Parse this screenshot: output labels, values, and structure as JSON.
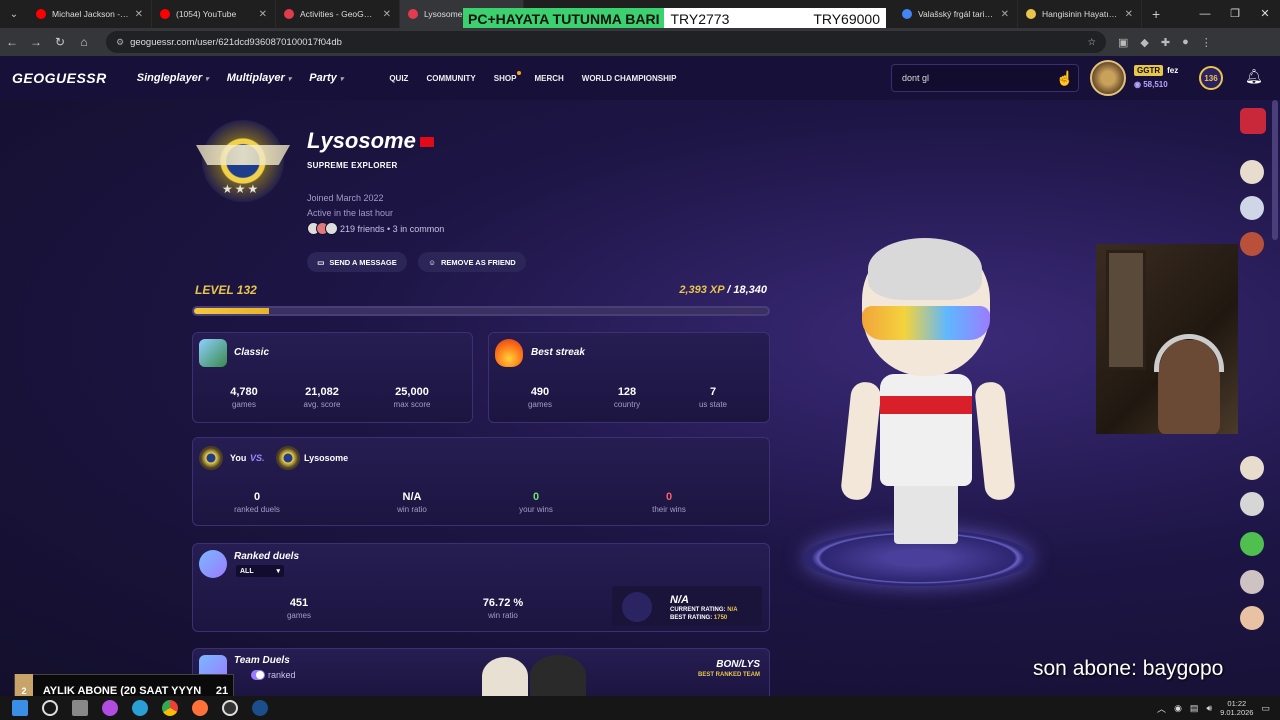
{
  "browser": {
    "tabs": [
      {
        "title": "Michael Jackson - Th",
        "favicon_color": "#ff0000"
      },
      {
        "title": "(1054) YouTube",
        "favicon_color": "#ff0000"
      },
      {
        "title": "Activities - GeoGuess",
        "favicon_color": "#e23b4e"
      },
      {
        "title": "Lysosome -",
        "favicon_color": "#e23b4e"
      },
      {
        "title": "Valašský frgál tarif - (",
        "favicon_color": "#4285f4"
      },
      {
        "title": "Hangisinin Hayatını Y",
        "favicon_color": "#e8c64b"
      }
    ],
    "url": "geoguessr.com/user/621dcd9360870100017f04db"
  },
  "stream_overlay_top": {
    "green_label": "PC+HAYATA TUTUNMA BARI",
    "middle_value": "TRY2773",
    "right_value": "TRY69000"
  },
  "site_nav": {
    "logo": "GEOGUESSR",
    "main": [
      "Singleplayer",
      "Multiplayer",
      "Party"
    ],
    "secondary": [
      "QUIZ",
      "COMMUNITY",
      "SHOP",
      "MERCH",
      "WORLD CHAMPIONSHIP"
    ],
    "search_value": "dont gl",
    "user_tag": "GGTR",
    "user_name": "fez",
    "coins": "58,510",
    "level_badge": "136"
  },
  "profile": {
    "name": "Lysosome",
    "title": "SUPREME EXPLORER",
    "joined": "Joined March 2022",
    "activity": "Active in the last hour",
    "friends": "219 friends • 3 in common",
    "send_message": "SEND A MESSAGE",
    "remove_friend": "REMOVE AS FRIEND",
    "level": "LEVEL 132",
    "xp_current": "2,393 XP",
    "xp_max": " / 18,340",
    "xp_progress": 0.13
  },
  "classic": {
    "title": "Classic",
    "stats": [
      {
        "value": "4,780",
        "label": "games"
      },
      {
        "value": "21,082",
        "label": "avg. score"
      },
      {
        "value": "25,000",
        "label": "max score"
      }
    ]
  },
  "best_streak": {
    "title": "Best streak",
    "stats": [
      {
        "value": "490",
        "label": "games"
      },
      {
        "value": "128",
        "label": "country"
      },
      {
        "value": "7",
        "label": "us state"
      }
    ]
  },
  "versus": {
    "you": "You",
    "vs": "VS.",
    "opponent": "Lysosome",
    "stats": [
      {
        "value": "0",
        "label": "ranked duels",
        "color": "#ffffff"
      },
      {
        "value": "N/A",
        "label": "win ratio",
        "color": "#ffffff"
      },
      {
        "value": "0",
        "label": "your wins",
        "color": "#6fe36f"
      },
      {
        "value": "0",
        "label": "their wins",
        "color": "#ff5d6c"
      }
    ]
  },
  "ranked_duels": {
    "title": "Ranked duels",
    "filter": "ALL",
    "games": "451",
    "games_label": "games",
    "win_ratio": "76.72 %",
    "win_ratio_label": "win ratio",
    "rating": "N/A",
    "current_rating_label": "CURRENT RATING:",
    "current_rating_value": "N/A",
    "best_rating_label": "BEST RATING:",
    "best_rating_value": "1750"
  },
  "team_duels": {
    "title": "Team Duels",
    "toggle_label": "ranked",
    "team_name": "BON/LYS",
    "team_caption": "BEST RANKED TEAM"
  },
  "subscriber_box": {
    "left_num": "2",
    "text": "AYLIK ABONE (20 SAAT YYYN",
    "right_num": "21"
  },
  "last_sub": "son abone: baygopo",
  "clock": {
    "time": "01:22",
    "date": "9.01.2026"
  }
}
